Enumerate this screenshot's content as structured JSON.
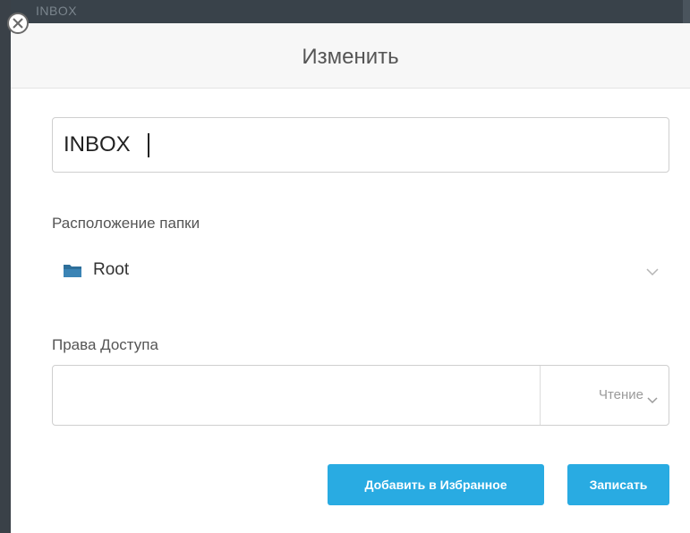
{
  "background": {
    "window_title": "INBOX"
  },
  "dialog": {
    "title": "Изменить",
    "name_field": {
      "value": "INBOX"
    },
    "folder_location": {
      "label": "Расположение папки",
      "value": "Root",
      "icon": "folder-icon"
    },
    "access": {
      "label": "Права Доступа",
      "input_value": "",
      "permission": "Чтение"
    },
    "buttons": {
      "favorite_label": "Добавить в Избранное",
      "save_label": "Записать"
    }
  },
  "colors": {
    "accent": "#29abe2",
    "header_bg": "#f7f7f7",
    "backdrop": "#39424a",
    "folder_icon": "#2e6f9a"
  }
}
